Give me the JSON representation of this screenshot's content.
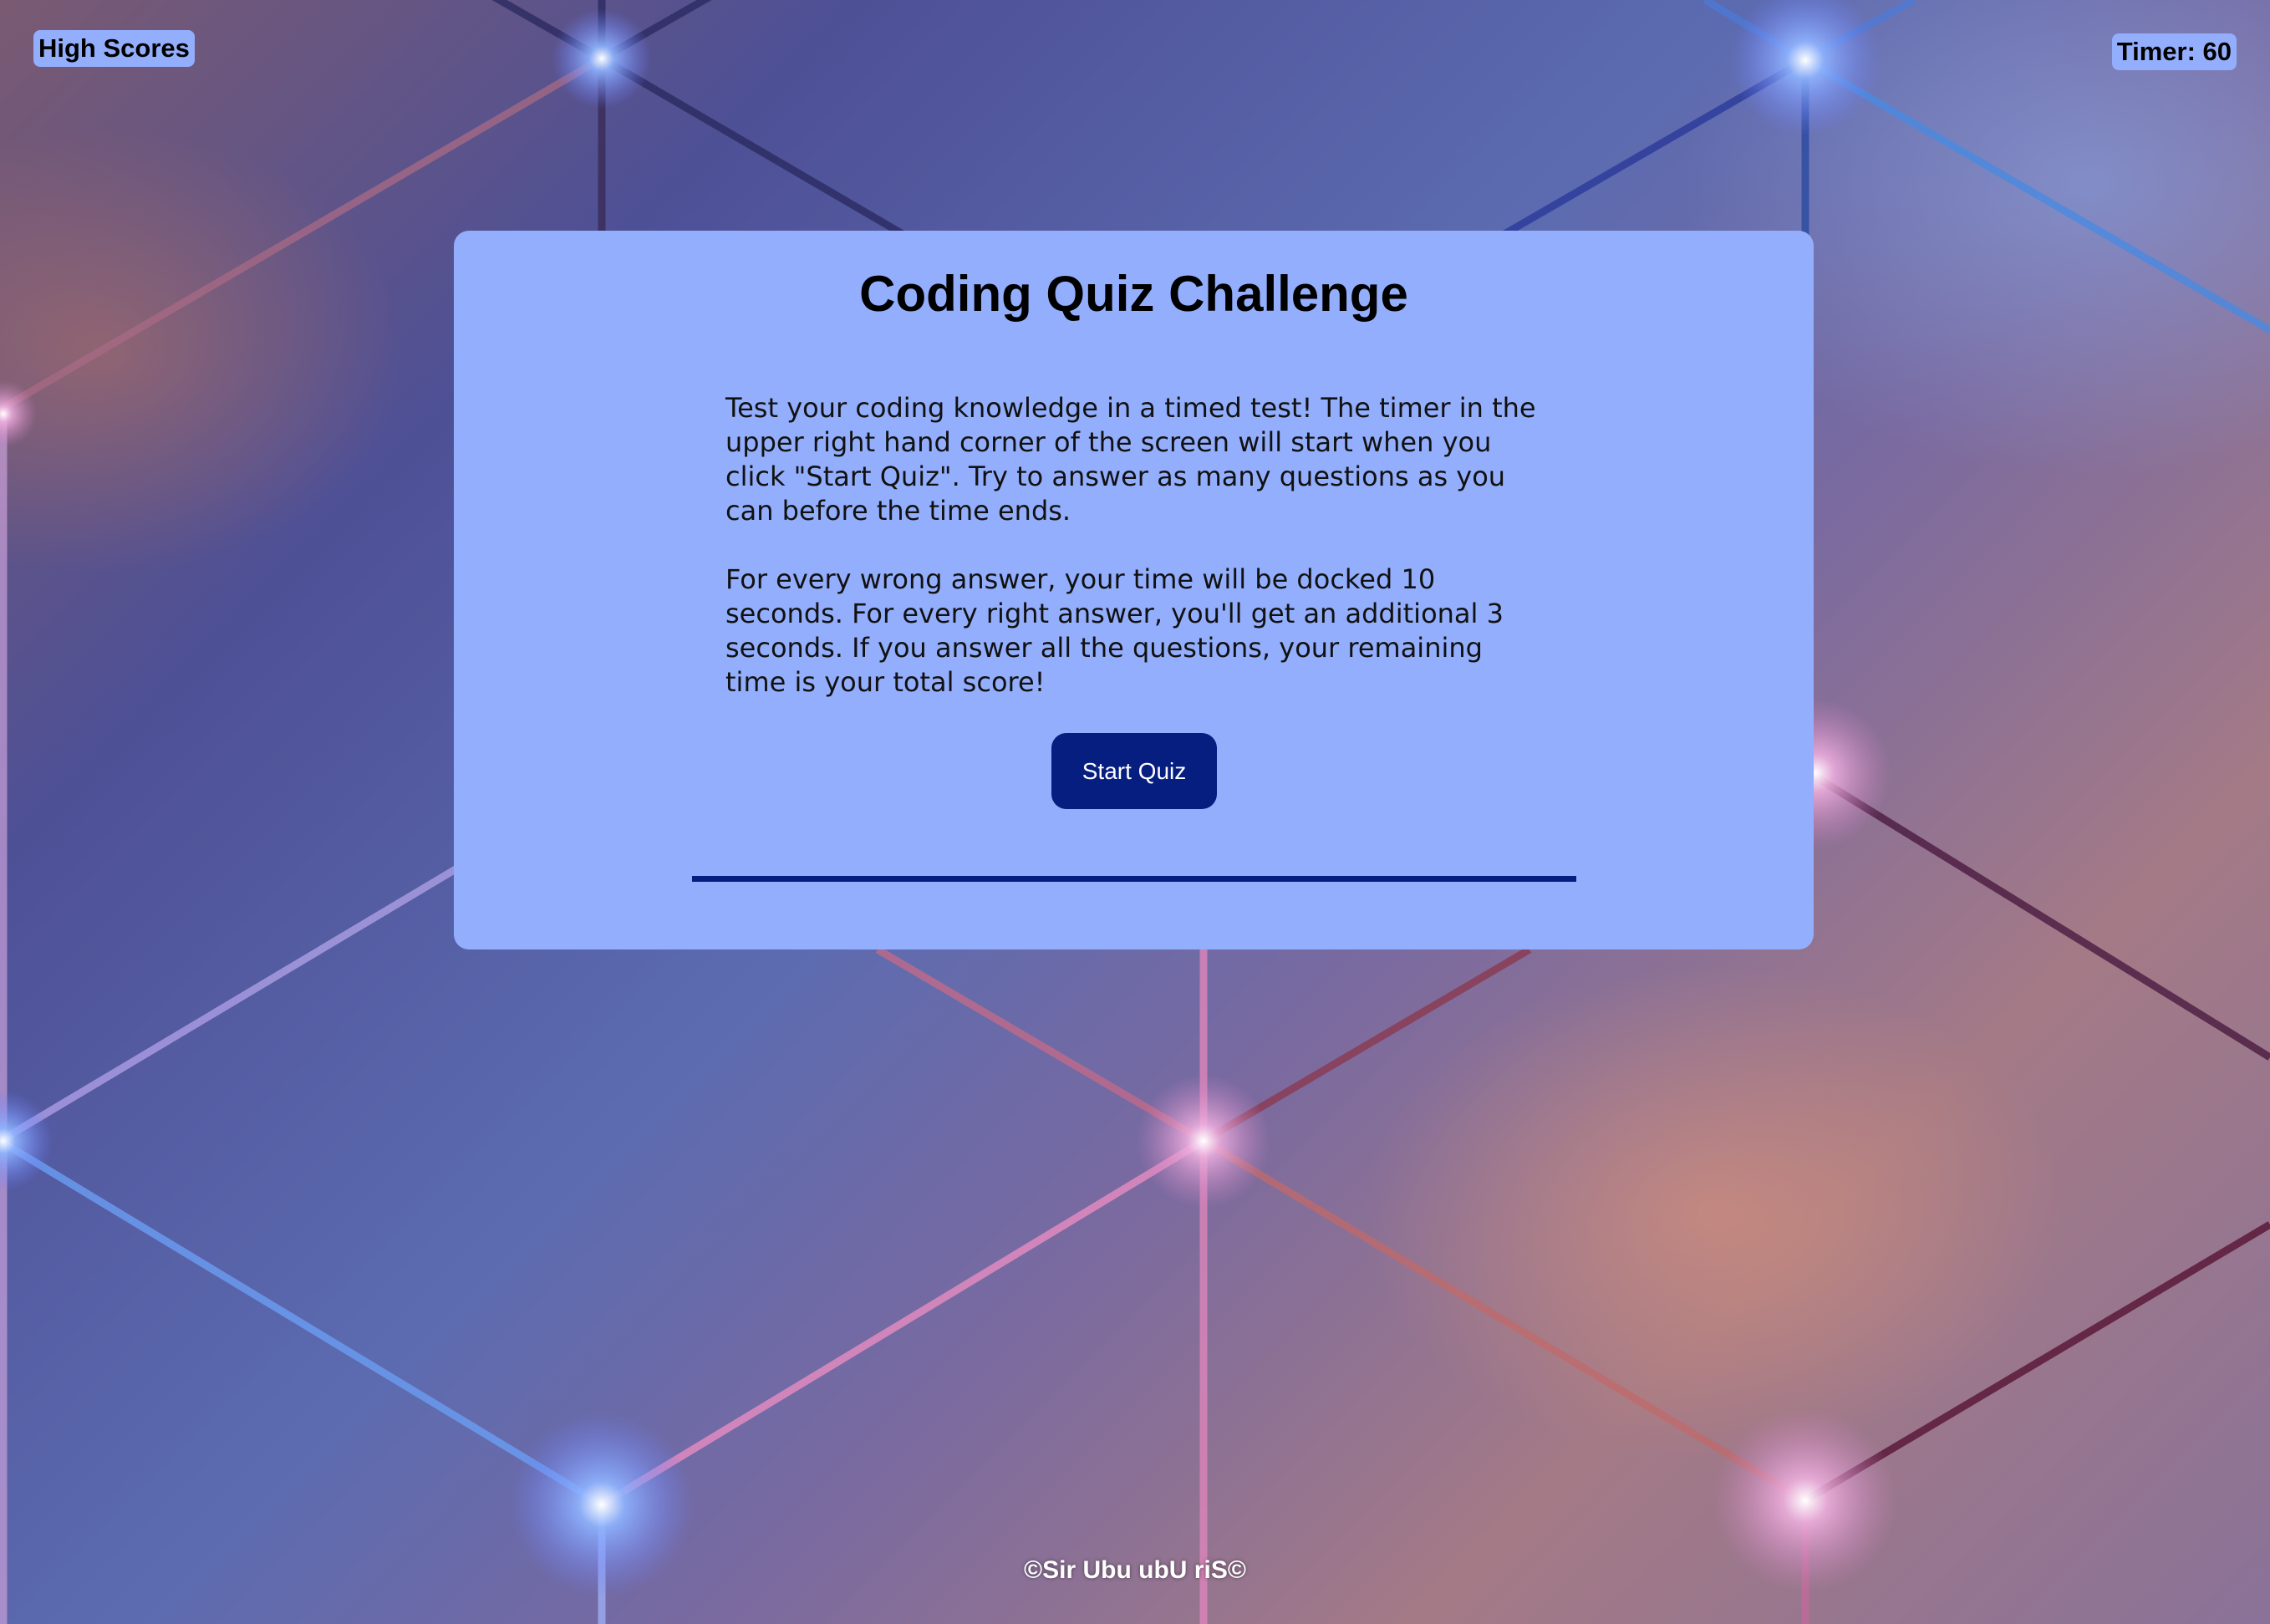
{
  "header": {
    "high_scores_label": "High Scores",
    "timer_label": "Timer: 60"
  },
  "quiz": {
    "title": "Coding Quiz Challenge",
    "intro_paragraph_1": "Test your coding knowledge in a timed test! The timer in the upper right hand corner of the screen will start when you click \"Start Quiz\". Try to answer as many questions as you can before the time ends.",
    "intro_paragraph_2": "For every wrong answer, your time will be docked 10 seconds. For every right answer, you'll get an additional 3 seconds. If you answer all the questions, your remaining time is your total score!",
    "start_button_label": "Start Quiz"
  },
  "footer": {
    "credit": "©Sir Ubu ubU riS©"
  },
  "colors": {
    "card_background": "#93aefc",
    "button_background": "#061e80",
    "divider": "#061e80"
  }
}
